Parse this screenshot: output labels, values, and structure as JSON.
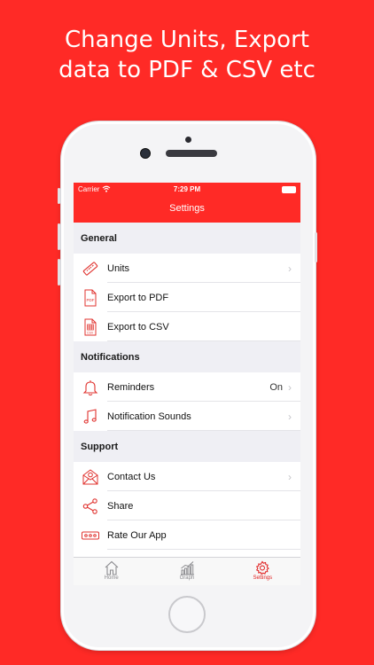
{
  "headline": {
    "line1": "Change Units, Export",
    "line2": "data to PDF & CSV etc"
  },
  "status_bar": {
    "carrier": "Carrier",
    "time": "7:29 PM"
  },
  "nav": {
    "title": "Settings"
  },
  "sections": [
    {
      "header": "General",
      "rows": [
        {
          "label": "Units",
          "icon": "ruler-icon",
          "value": "",
          "chevron": true
        },
        {
          "label": "Export to PDF",
          "icon": "pdf-file-icon",
          "value": "",
          "chevron": false
        },
        {
          "label": "Export to CSV",
          "icon": "csv-file-icon",
          "value": "",
          "chevron": false
        }
      ]
    },
    {
      "header": "Notifications",
      "rows": [
        {
          "label": "Reminders",
          "icon": "bell-icon",
          "value": "On",
          "chevron": true
        },
        {
          "label": "Notification Sounds",
          "icon": "music-note-icon",
          "value": "",
          "chevron": true
        }
      ]
    },
    {
      "header": "Support",
      "rows": [
        {
          "label": "Contact Us",
          "icon": "mail-icon",
          "value": "",
          "chevron": true
        },
        {
          "label": "Share",
          "icon": "share-icon",
          "value": "",
          "chevron": false
        },
        {
          "label": "Rate Our App",
          "icon": "rating-icon",
          "value": "",
          "chevron": false
        }
      ]
    }
  ],
  "tabs": [
    {
      "label": "Home",
      "icon": "home-icon",
      "active": false
    },
    {
      "label": "Graph",
      "icon": "graph-icon",
      "active": false
    },
    {
      "label": "Settings",
      "icon": "gear-icon",
      "active": true
    }
  ],
  "colors": {
    "accent": "#ff2a26",
    "icon": "#e0332f",
    "section_bg": "#efeff4"
  }
}
